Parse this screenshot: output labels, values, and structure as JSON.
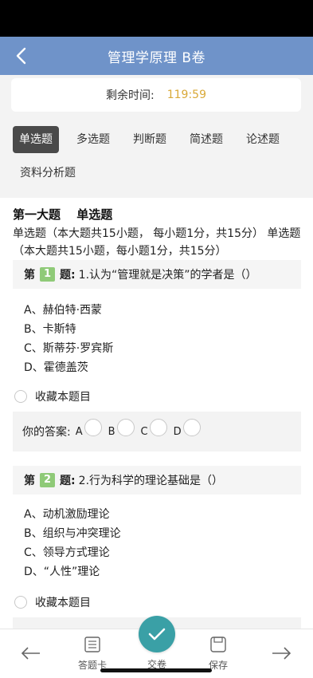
{
  "header": {
    "title": "管理学原理 B卷"
  },
  "timer": {
    "label": "剩余时间:",
    "value": "119:59"
  },
  "tabs": [
    {
      "label": "单选题",
      "active": true
    },
    {
      "label": "多选题",
      "active": false
    },
    {
      "label": "判断题",
      "active": false
    },
    {
      "label": "简述题",
      "active": false
    },
    {
      "label": "论述题",
      "active": false
    },
    {
      "label": "资料分析题",
      "active": false
    }
  ],
  "section": {
    "title": "第一大题　 单选题",
    "description": "单选题（本大题共15小题， 每小题1分，共15分） 单选题（本大题共15小题，每小题1分，共15分）"
  },
  "questions": [
    {
      "prefix": "第",
      "number": "1",
      "suffix": "题:",
      "text": "1.认为“管理就是决策”的学者是（）",
      "options": [
        "A、赫伯特·西蒙",
        "B、卡斯特",
        "C、斯蒂芬·罗宾斯",
        "D、霍德盖茨"
      ],
      "favorite_label": "收藏本题目",
      "answer_label": "你的答案:",
      "answer_choices": [
        "A",
        "B",
        "C",
        "D"
      ]
    },
    {
      "prefix": "第",
      "number": "2",
      "suffix": "题:",
      "text": "2.行为科学的理论基础是（）",
      "options": [
        "A、动机激励理论",
        "B、组织与冲突理论",
        "C、领导方式理论",
        "D、“人性”理论"
      ],
      "favorite_label": "收藏本题目"
    }
  ],
  "bottom_bar": {
    "answer_card": "答题卡",
    "submit": "交卷",
    "save": "保存"
  },
  "colors": {
    "nav": "#6f93c9",
    "timer_value": "#d9a938",
    "question_number": "#8fca78",
    "submit_button": "#3aa0a6"
  }
}
